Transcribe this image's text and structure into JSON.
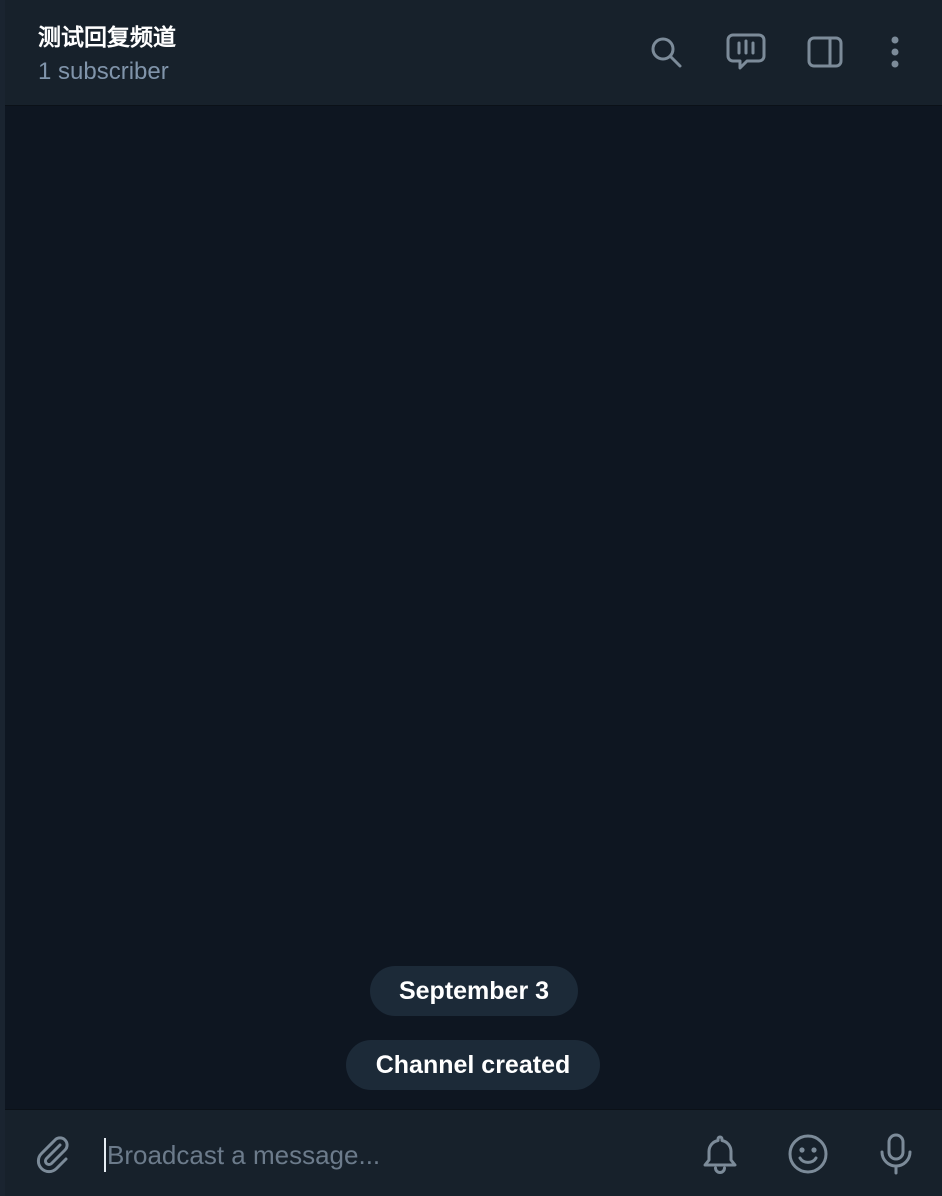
{
  "header": {
    "title": "测试回复频道",
    "subtitle": "1 subscriber",
    "actions": [
      {
        "name": "search",
        "icon": "search-icon"
      },
      {
        "name": "discussion",
        "icon": "discussion-icon"
      },
      {
        "name": "sidebar",
        "icon": "sidebar-panel-icon"
      },
      {
        "name": "more",
        "icon": "more-vertical-icon"
      }
    ]
  },
  "messages": {
    "date_label": "September 3",
    "service_message": "Channel created"
  },
  "composer": {
    "placeholder": "Broadcast a message...",
    "value": "",
    "icons": {
      "attach": "paperclip-icon",
      "silent": "bell-icon",
      "emoji": "emoji-icon",
      "voice": "microphone-icon"
    }
  },
  "colors": {
    "background": "#0e1621",
    "panel": "#17212b",
    "pill": "#1c2a38",
    "icon": "#7c8b99",
    "subtitle": "#8094aa",
    "placeholder": "#6c7b8b"
  }
}
